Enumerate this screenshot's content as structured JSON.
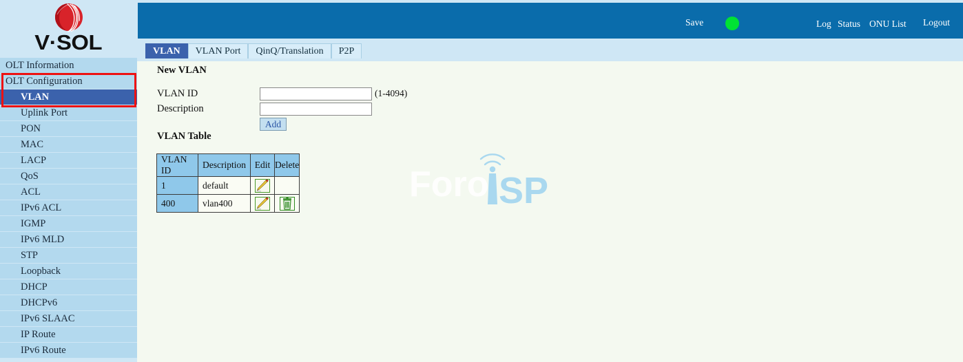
{
  "brand": {
    "logo_icon": "vsol-orb-icon",
    "wordmark": "V·SOL"
  },
  "sidebar": {
    "items": [
      {
        "label": "OLT Information",
        "level": "top",
        "active": false
      },
      {
        "label": "OLT Configuration",
        "level": "top",
        "active": false
      },
      {
        "label": "VLAN",
        "level": "sub",
        "active": true
      },
      {
        "label": "Uplink Port",
        "level": "sub",
        "active": false
      },
      {
        "label": "PON",
        "level": "sub",
        "active": false
      },
      {
        "label": "MAC",
        "level": "sub",
        "active": false
      },
      {
        "label": "LACP",
        "level": "sub",
        "active": false
      },
      {
        "label": "QoS",
        "level": "sub",
        "active": false
      },
      {
        "label": "ACL",
        "level": "sub",
        "active": false
      },
      {
        "label": "IPv6 ACL",
        "level": "sub",
        "active": false
      },
      {
        "label": "IGMP",
        "level": "sub",
        "active": false
      },
      {
        "label": "IPv6 MLD",
        "level": "sub",
        "active": false
      },
      {
        "label": "STP",
        "level": "sub",
        "active": false
      },
      {
        "label": "Loopback",
        "level": "sub",
        "active": false
      },
      {
        "label": "DHCP",
        "level": "sub",
        "active": false
      },
      {
        "label": "DHCPv6",
        "level": "sub",
        "active": false
      },
      {
        "label": "IPv6 SLAAC",
        "level": "sub",
        "active": false
      },
      {
        "label": "IP Route",
        "level": "sub",
        "active": false
      },
      {
        "label": "IPv6 Route",
        "level": "sub",
        "active": false
      }
    ],
    "highlight_color": "#ee1111",
    "active_color": "#3b62ac"
  },
  "header": {
    "save_label": "Save",
    "status_dot_color": "#00e234",
    "log_label": "Log",
    "status_label": "Status",
    "onu_list_label": "ONU List",
    "logout_label": "Logout",
    "bar_color": "#0a6cab"
  },
  "tabs": [
    {
      "label": "VLAN",
      "active": true
    },
    {
      "label": "VLAN Port",
      "active": false
    },
    {
      "label": "QinQ/Translation",
      "active": false
    },
    {
      "label": "P2P",
      "active": false
    }
  ],
  "main": {
    "new_vlan_title": "New VLAN",
    "vlan_id_label": "VLAN ID",
    "vlan_id_value": "",
    "vlan_id_placeholder": "",
    "vlan_id_hint": "(1-4094)",
    "description_label": "Description",
    "description_value": "",
    "description_placeholder": "",
    "add_button_label": "Add",
    "vlan_table_title": "VLAN Table",
    "table": {
      "columns": [
        "VLAN ID",
        "Description",
        "Edit",
        "Delete"
      ],
      "rows": [
        {
          "vlan_id": "1",
          "description": "default",
          "edit_icon": "pencil-edit-icon",
          "delete_icon": ""
        },
        {
          "vlan_id": "400",
          "description": "vlan400",
          "edit_icon": "pencil-edit-icon",
          "delete_icon": "trash-delete-icon"
        }
      ]
    }
  },
  "watermark": {
    "text_light": "Foro",
    "text_accent": "SP",
    "accent_color": "#a9d8ef"
  }
}
